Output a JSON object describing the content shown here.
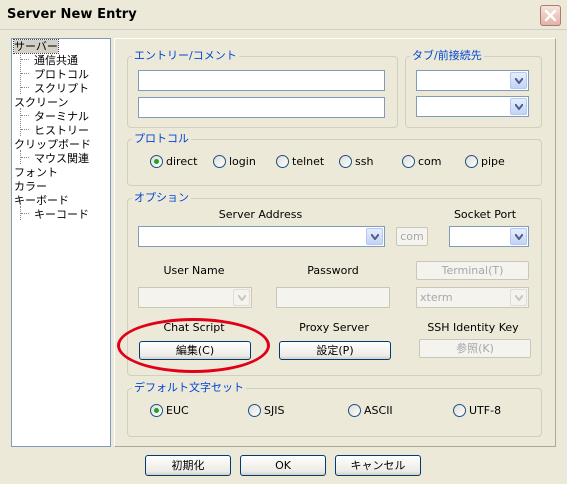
{
  "window": {
    "title": "Server New Entry"
  },
  "tree": {
    "items": [
      {
        "label": "サーバー",
        "level": 0,
        "selected": true
      },
      {
        "label": "通信共通",
        "level": 1
      },
      {
        "label": "プロトコル",
        "level": 1
      },
      {
        "label": "スクリプト",
        "level": 1
      },
      {
        "label": "スクリーン",
        "level": 0
      },
      {
        "label": "ターミナル",
        "level": 1
      },
      {
        "label": "ヒストリー",
        "level": 1
      },
      {
        "label": "クリップボード",
        "level": 0
      },
      {
        "label": "マウス関連",
        "level": 1
      },
      {
        "label": "フォント",
        "level": 0
      },
      {
        "label": "カラー",
        "level": 0
      },
      {
        "label": "キーボード",
        "level": 0
      },
      {
        "label": "キーコード",
        "level": 1
      }
    ]
  },
  "entry": {
    "legend": "エントリー/コメント",
    "entry_value": "",
    "comment_value": ""
  },
  "tab": {
    "legend": "タブ/前接続先",
    "tab_value": "",
    "prev_value": ""
  },
  "protocol": {
    "legend": "プロトコル",
    "options": [
      "direct",
      "login",
      "telnet",
      "ssh",
      "com",
      "pipe"
    ],
    "selected": "direct"
  },
  "options": {
    "legend": "オプション",
    "server_address_label": "Server Address",
    "server_address_value": "",
    "com_button": "com",
    "socket_port_label": "Socket Port",
    "socket_port_value": "",
    "user_name_label": "User Name",
    "user_name_value": "",
    "password_label": "Password",
    "password_value": "",
    "terminal_button": "Terminal(T)",
    "terminal_value": "xterm",
    "chat_script_label": "Chat Script",
    "chat_script_button": "編集(C)",
    "proxy_server_label": "Proxy Server",
    "proxy_server_button": "設定(P)",
    "ssh_key_label": "SSH Identity Key",
    "ssh_key_button": "参照(K)"
  },
  "charset": {
    "legend": "デフォルト文字セット",
    "options": [
      "EUC",
      "SJIS",
      "ASCII",
      "UTF-8"
    ],
    "selected": "EUC"
  },
  "footer": {
    "init_button": "初期化",
    "ok_button": "OK",
    "cancel_button": "キャンセル"
  },
  "colors": {
    "legend_text": "#0046d5",
    "highlight_ellipse": "#e1001a",
    "radio_dot": "#21a121"
  }
}
